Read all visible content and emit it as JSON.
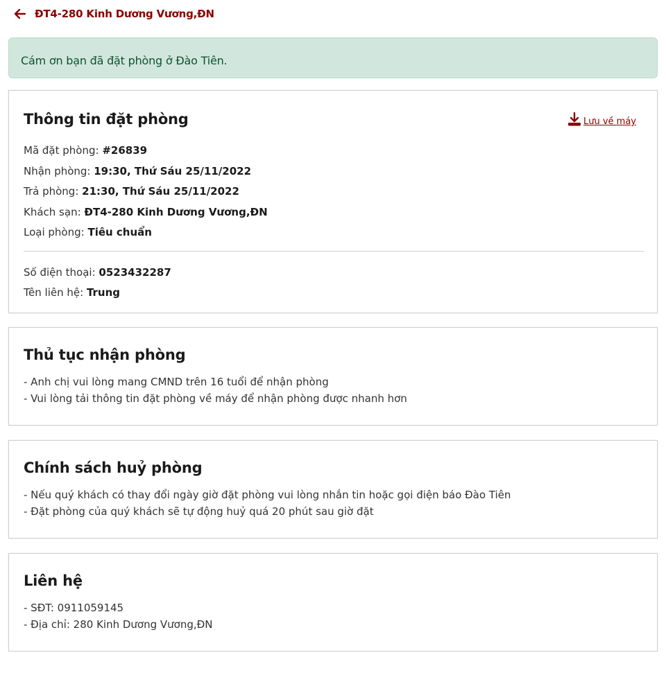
{
  "header": {
    "title": "ĐT4-280 Kinh Dương Vương,ĐN"
  },
  "alert": {
    "message": "Cám ơn bạn đã đặt phòng ở Đào Tiên."
  },
  "booking": {
    "title": "Thông tin đặt phòng",
    "save_label": "Lưu về máy",
    "code_label": "Mã đặt phòng: ",
    "code_value": "#26839",
    "checkin_label": "Nhận phòng: ",
    "checkin_value": "19:30, Thứ Sáu 25/11/2022",
    "checkout_label": "Trả phòng: ",
    "checkout_value": "21:30, Thứ Sáu 25/11/2022",
    "hotel_label": "Khách sạn: ",
    "hotel_value": "ĐT4-280 Kinh Dương Vương,ĐN",
    "room_label": "Loại phòng: ",
    "room_value": "Tiêu chuẩn",
    "phone_label": "Số điện thoại: ",
    "phone_value": "0523432287",
    "contact_label": "Tên liên hệ: ",
    "contact_value": "Trung"
  },
  "checkin_procedure": {
    "title": "Thủ tục nhận phòng",
    "lines": [
      "- Anh chị vui lòng mang CMND trên 16 tuổi để nhận phòng",
      "- Vui lòng tải thông tin đặt phòng về máy để nhận phòng được nhanh hơn"
    ]
  },
  "cancel_policy": {
    "title": "Chính sách huỷ phòng",
    "lines": [
      "- Nếu quý khách có thay đổi ngày giờ đặt phòng vui lòng nhắn tin hoặc gọi điện báo Đào Tiên",
      "- Đặt phòng của quý khách sẽ tự động huỷ quá 20 phút sau giờ đặt"
    ]
  },
  "contact": {
    "title": "Liên hệ",
    "lines": [
      "- SĐT: 0911059145",
      "- Địa chỉ: 280 Kinh Dương Vương,ĐN"
    ]
  },
  "colors": {
    "brand": "#8b0000",
    "alert_bg": "#d1e7dd",
    "alert_text": "#0f5132"
  },
  "icons": {
    "back": "arrow-left-icon",
    "save": "download-icon"
  }
}
